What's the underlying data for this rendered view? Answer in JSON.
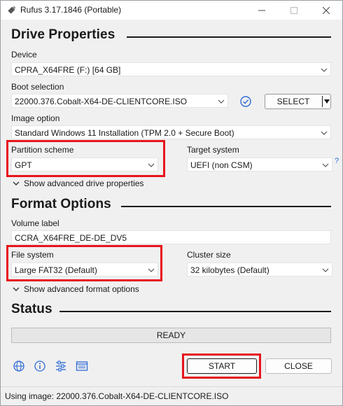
{
  "window": {
    "title": "Rufus 3.17.1846 (Portable)"
  },
  "drive_properties": {
    "heading": "Drive Properties",
    "device_label": "Device",
    "device_value": "CPRA_X64FRE (F:) [64 GB]",
    "boot_label": "Boot selection",
    "boot_value": "22000.376.Cobalt-X64-DE-CLIENTCORE.ISO",
    "select_button": "SELECT",
    "image_option_label": "Image option",
    "image_option_value": "Standard Windows 11 Installation (TPM 2.0 + Secure Boot)",
    "partition_label": "Partition scheme",
    "partition_value": "GPT",
    "target_label": "Target system",
    "target_value": "UEFI (non CSM)",
    "target_help": "?",
    "advanced_toggle": "Show advanced drive properties"
  },
  "format_options": {
    "heading": "Format Options",
    "volume_label": "Volume label",
    "volume_value": "CCRA_X64FRE_DE-DE_DV5",
    "fs_label": "File system",
    "fs_value": "Large FAT32 (Default)",
    "cluster_label": "Cluster size",
    "cluster_value": "32 kilobytes (Default)",
    "advanced_toggle": "Show advanced format options"
  },
  "status": {
    "heading": "Status",
    "progress_text": "READY"
  },
  "actions": {
    "start_button": "START",
    "close_button": "CLOSE"
  },
  "toolbar_icons": [
    "globe-icon",
    "info-icon",
    "settings-icon",
    "log-icon"
  ],
  "statusbar": {
    "text": "Using image: 22000.376.Cobalt-X64-DE-CLIENTCORE.ISO"
  },
  "colors": {
    "highlight": "#e8141c",
    "accent": "#2f6ad6"
  }
}
